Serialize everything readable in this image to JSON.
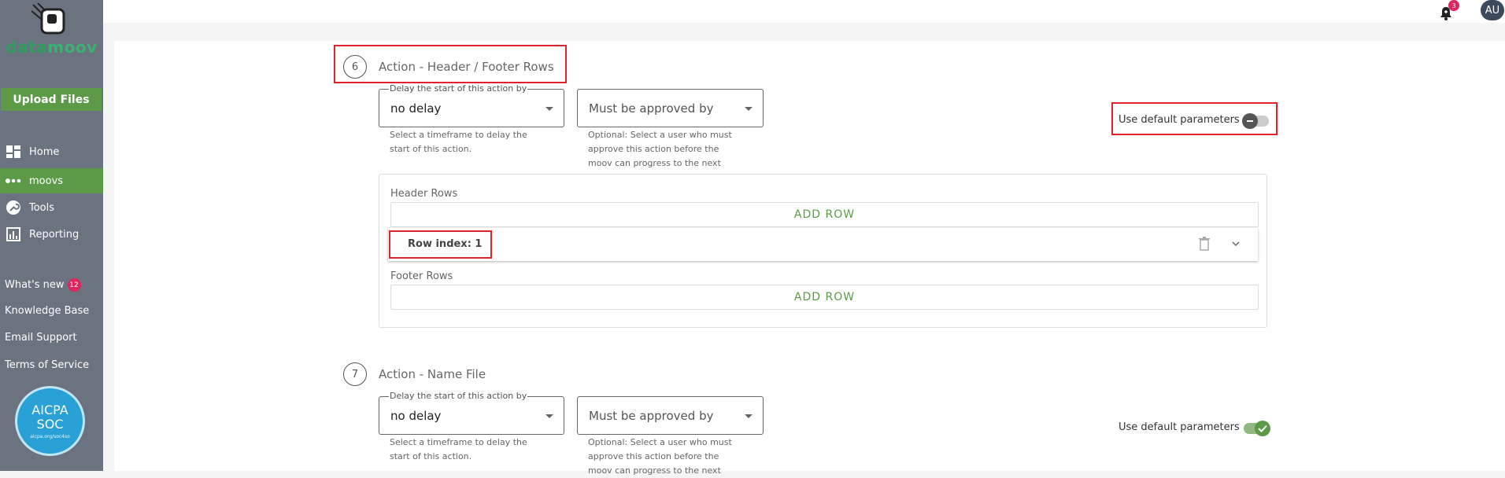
{
  "sidebar": {
    "logo": {
      "part1": "data",
      "part2": "moov"
    },
    "upload_label": "Upload Files",
    "nav": [
      {
        "label": "Home",
        "icon": "dashboard-icon"
      },
      {
        "label": "moovs",
        "icon": "dots-icon",
        "active": true
      },
      {
        "label": "Tools",
        "icon": "wrench-icon"
      },
      {
        "label": "Reporting",
        "icon": "chart-icon"
      }
    ],
    "links": {
      "whats_new": "What's new",
      "whats_new_badge": "12",
      "knowledge_base": "Knowledge Base",
      "email_support": "Email Support",
      "terms": "Terms of Service"
    },
    "badge_seal": {
      "line1": "AICPA",
      "line2": "SOC",
      "line3": "aicpa.org/soc4so"
    }
  },
  "topbar": {
    "notification_count": "3",
    "avatar_initials": "AU"
  },
  "steps": [
    {
      "number": "6",
      "title": "Action - Header / Footer Rows",
      "delay": {
        "legend": "Delay the start of this action by",
        "value": "no delay",
        "helper1": "Select a timeframe to delay the",
        "helper2": "start of this action."
      },
      "approval": {
        "placeholder": "Must be approved by",
        "helper1": "Optional: Select a user who must",
        "helper2": "approve this action before the",
        "helper3": "moov can progress to the next"
      },
      "default_params_label": "Use default parameters",
      "default_params_on": false,
      "header_rows_label": "Header Rows",
      "add_row_label": "ADD ROW",
      "row_item_label": "Row index: 1",
      "footer_rows_label": "Footer Rows"
    },
    {
      "number": "7",
      "title": "Action - Name File",
      "delay": {
        "legend": "Delay the start of this action by",
        "value": "no delay",
        "helper1": "Select a timeframe to delay the",
        "helper2": "start of this action."
      },
      "approval": {
        "placeholder": "Must be approved by",
        "helper1": "Optional: Select a user who must",
        "helper2": "approve this action before the",
        "helper3": "moov can progress to the next"
      },
      "default_params_label": "Use default parameters",
      "default_params_on": true
    }
  ],
  "colors": {
    "accent": "#5c9a48",
    "highlight": "#e0222f",
    "sidebar": "#6b7280"
  }
}
